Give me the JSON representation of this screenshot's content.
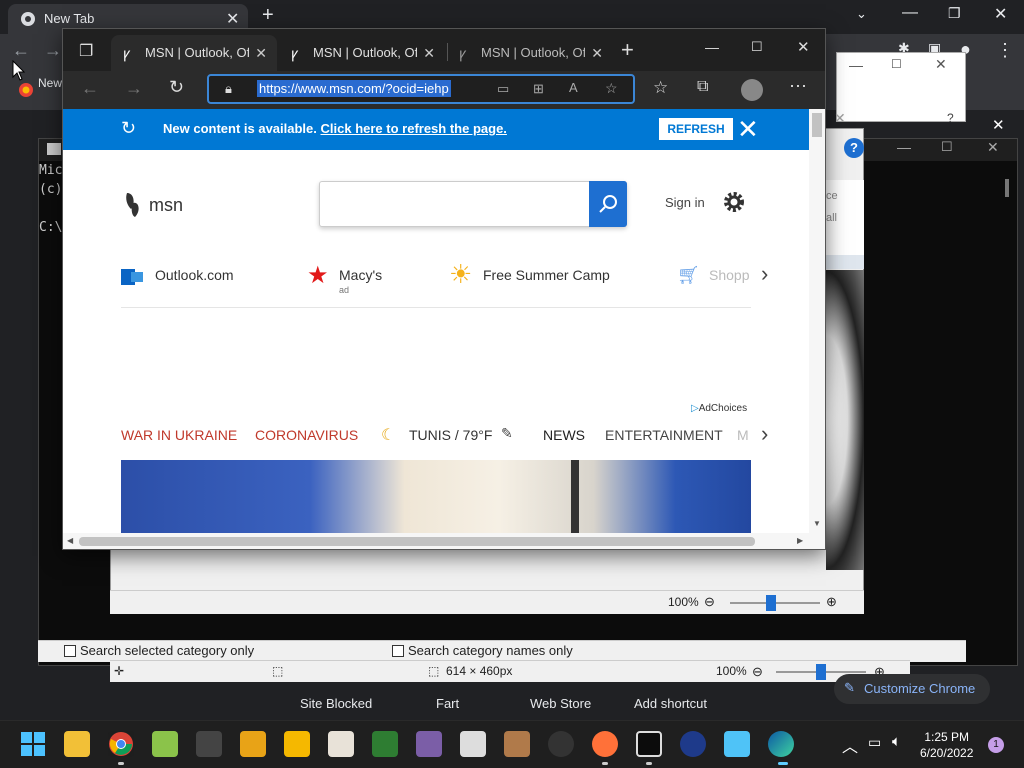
{
  "chrome": {
    "tab_title": "New Tab",
    "bookmark_new": "New",
    "search_opts": {
      "selected_only": "Search selected category only",
      "names_only": "Search category names only"
    },
    "paint_status": {
      "dimensions": "614 × 460px",
      "zoom": "100%"
    },
    "viewer_zoom": "100%",
    "viewer_side": [
      "ce",
      "all"
    ],
    "shortcuts": [
      "Site Blocked",
      "Fart",
      "Web Store",
      "Add shortcut"
    ],
    "customize": "Customize Chrome",
    "cmd_lines": "Mic\n(c)\n\nC:\\"
  },
  "edge": {
    "tabs": [
      {
        "title": "MSN | Outlook, Office"
      },
      {
        "title": "MSN | Outlook, Office"
      },
      {
        "title": "MSN | Outlook, Office"
      }
    ],
    "url": "https://www.msn.com/?ocid=iehp",
    "notice": {
      "text": "New content is available.",
      "link": "Click here to refresh the page.",
      "button": "REFRESH"
    },
    "msn": {
      "logo_text": "msn",
      "search_placeholder": "",
      "sign_in": "Sign in",
      "quicklinks": [
        {
          "label": "Outlook.com"
        },
        {
          "label": "Macy's",
          "sub": "ad"
        },
        {
          "label": "Free Summer Camp"
        },
        {
          "label": "Shopp"
        }
      ],
      "adchoices": "AdChoices",
      "categories": {
        "war": "WAR IN UKRAINE",
        "corona": "CORONAVIRUS",
        "weather": "TUNIS / 79°F",
        "news": "NEWS",
        "entertainment": "ENTERTAINMENT",
        "more": "M"
      }
    }
  },
  "taskbar": {
    "time": "1:25 PM",
    "date": "6/20/2022",
    "notifications": "1"
  },
  "colors": {
    "edge_accent": "#0078d4",
    "war_category": "#c0392b"
  }
}
